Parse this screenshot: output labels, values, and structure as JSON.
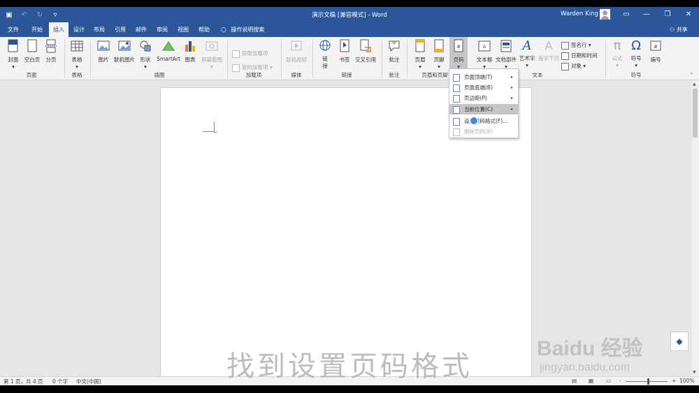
{
  "titlebar": {
    "title": "演示文稿 [兼容模式] - Word",
    "user": "Warden King",
    "qat_icons": [
      "save-icon",
      "undo-icon",
      "redo-icon",
      "customize-qat-icon"
    ],
    "window_buttons": [
      "ribbon-display-icon",
      "minimize-icon",
      "restore-icon",
      "close-icon"
    ]
  },
  "tabs": [
    "文件",
    "开始",
    "插入",
    "设计",
    "布局",
    "引用",
    "邮件",
    "审阅",
    "视图",
    "帮助"
  ],
  "active_tab": "插入",
  "tell_me": "操作说明搜索",
  "share": "共享",
  "ribbon": {
    "pages": {
      "cover": "封面",
      "blank": "空白页",
      "break": "分页",
      "label": "页面"
    },
    "tables": {
      "table": "表格",
      "label": "表格"
    },
    "illustrations": {
      "picture": "图片",
      "online_picture": "联机图片",
      "shapes": "形状",
      "smartart": "SmartArt",
      "chart": "图表",
      "screenshot": "屏幕截图",
      "label": "插图"
    },
    "addins": {
      "get": "获取加载项",
      "mine": "我的加载项",
      "label": "加载项"
    },
    "media": {
      "video": "联机视频",
      "label": "媒体"
    },
    "links": {
      "link": "链接",
      "bookmark": "书签",
      "crossref": "交叉引用",
      "label": "链接"
    },
    "comments": {
      "comment": "批注",
      "label": "批注"
    },
    "header_footer": {
      "header": "页眉",
      "footer": "页脚",
      "page_number": "页码",
      "label": "页眉和页脚"
    },
    "text": {
      "textbox": "文本框",
      "quickparts": "文档部件",
      "wordart": "艺术字",
      "dropcap": "首字下沉",
      "signature": "签名行",
      "datetime": "日期和时间",
      "object": "对象",
      "label": "文本"
    },
    "symbols": {
      "equation": "公式",
      "symbol": "符号",
      "number": "编号",
      "label": "符号"
    }
  },
  "page_number_menu": [
    {
      "label": "页面顶端(T)",
      "submenu": true,
      "state": "normal"
    },
    {
      "label": "页面底端(B)",
      "submenu": true,
      "state": "normal"
    },
    {
      "label": "页边距(P)",
      "submenu": true,
      "state": "normal"
    },
    {
      "label": "当前位置(C)",
      "submenu": true,
      "state": "highlighted"
    },
    {
      "label": "设置页码格式(F)...",
      "submenu": false,
      "state": "normal"
    },
    {
      "label": "删除页码(R)",
      "submenu": false,
      "state": "disabled"
    }
  ],
  "document": {
    "paragraph_mark": "↵"
  },
  "statusbar": {
    "page_info": "第 1 页，共 4 页",
    "word_count": "0 个字",
    "language": "中文(中国)",
    "zoom_minus": "-",
    "zoom_plus": "+",
    "zoom": "100%",
    "zoom_level_percent": 100
  },
  "overlay": {
    "caption": "找到设置页码格式",
    "watermark_brand": "Baidu 经验",
    "watermark_url": "jingyan.baidu.com"
  }
}
